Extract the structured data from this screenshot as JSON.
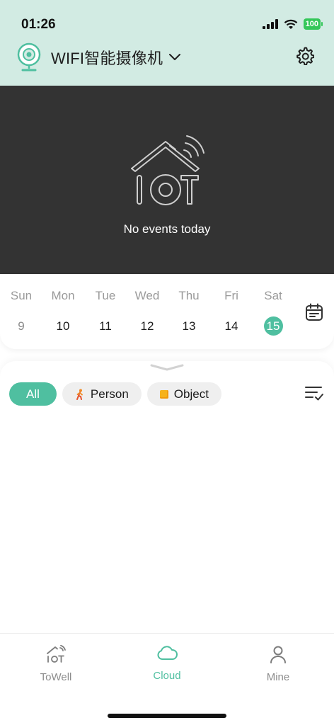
{
  "status_bar": {
    "time": "01:26",
    "battery": "100"
  },
  "header": {
    "device_title": "WIFI智能摄像机"
  },
  "player": {
    "message": "No events today"
  },
  "calendar": {
    "days": [
      {
        "name": "Sun",
        "date": "9"
      },
      {
        "name": "Mon",
        "date": "10"
      },
      {
        "name": "Tue",
        "date": "11"
      },
      {
        "name": "Wed",
        "date": "12"
      },
      {
        "name": "Thu",
        "date": "13"
      },
      {
        "name": "Fri",
        "date": "14"
      },
      {
        "name": "Sat",
        "date": "15"
      }
    ],
    "selected_date": "15"
  },
  "filters": {
    "all_label": "All",
    "person_label": "Person",
    "object_label": "Object"
  },
  "tabbar": {
    "tabs": [
      {
        "label": "ToWell"
      },
      {
        "label": "Cloud"
      },
      {
        "label": "Mine"
      }
    ],
    "active": "Cloud"
  },
  "colors": {
    "accent": "#4fbfa0",
    "header_bg": "#d2ebe3",
    "player_bg": "#333333"
  }
}
